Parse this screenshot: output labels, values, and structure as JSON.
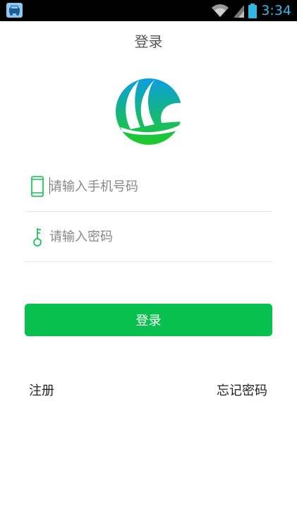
{
  "status_bar": {
    "time": "3:34",
    "icons": [
      "app-notification-icon",
      "wifi-icon",
      "signal-icon",
      "battery-icon"
    ],
    "accent_color": "#33b5e5"
  },
  "header": {
    "title": "登录"
  },
  "form": {
    "phone": {
      "placeholder": "请输入手机号码",
      "value": "",
      "icon": "phone-icon"
    },
    "password": {
      "placeholder": "请输入密码",
      "value": "",
      "icon": "key-icon"
    }
  },
  "login_button": {
    "label": "登录",
    "color": "#08c04e"
  },
  "links": {
    "register": "注册",
    "forgot_password": "忘记密码"
  },
  "colors": {
    "primary_green": "#08c04e",
    "logo_blue": "#0aa0d8",
    "logo_green": "#18c72c"
  }
}
